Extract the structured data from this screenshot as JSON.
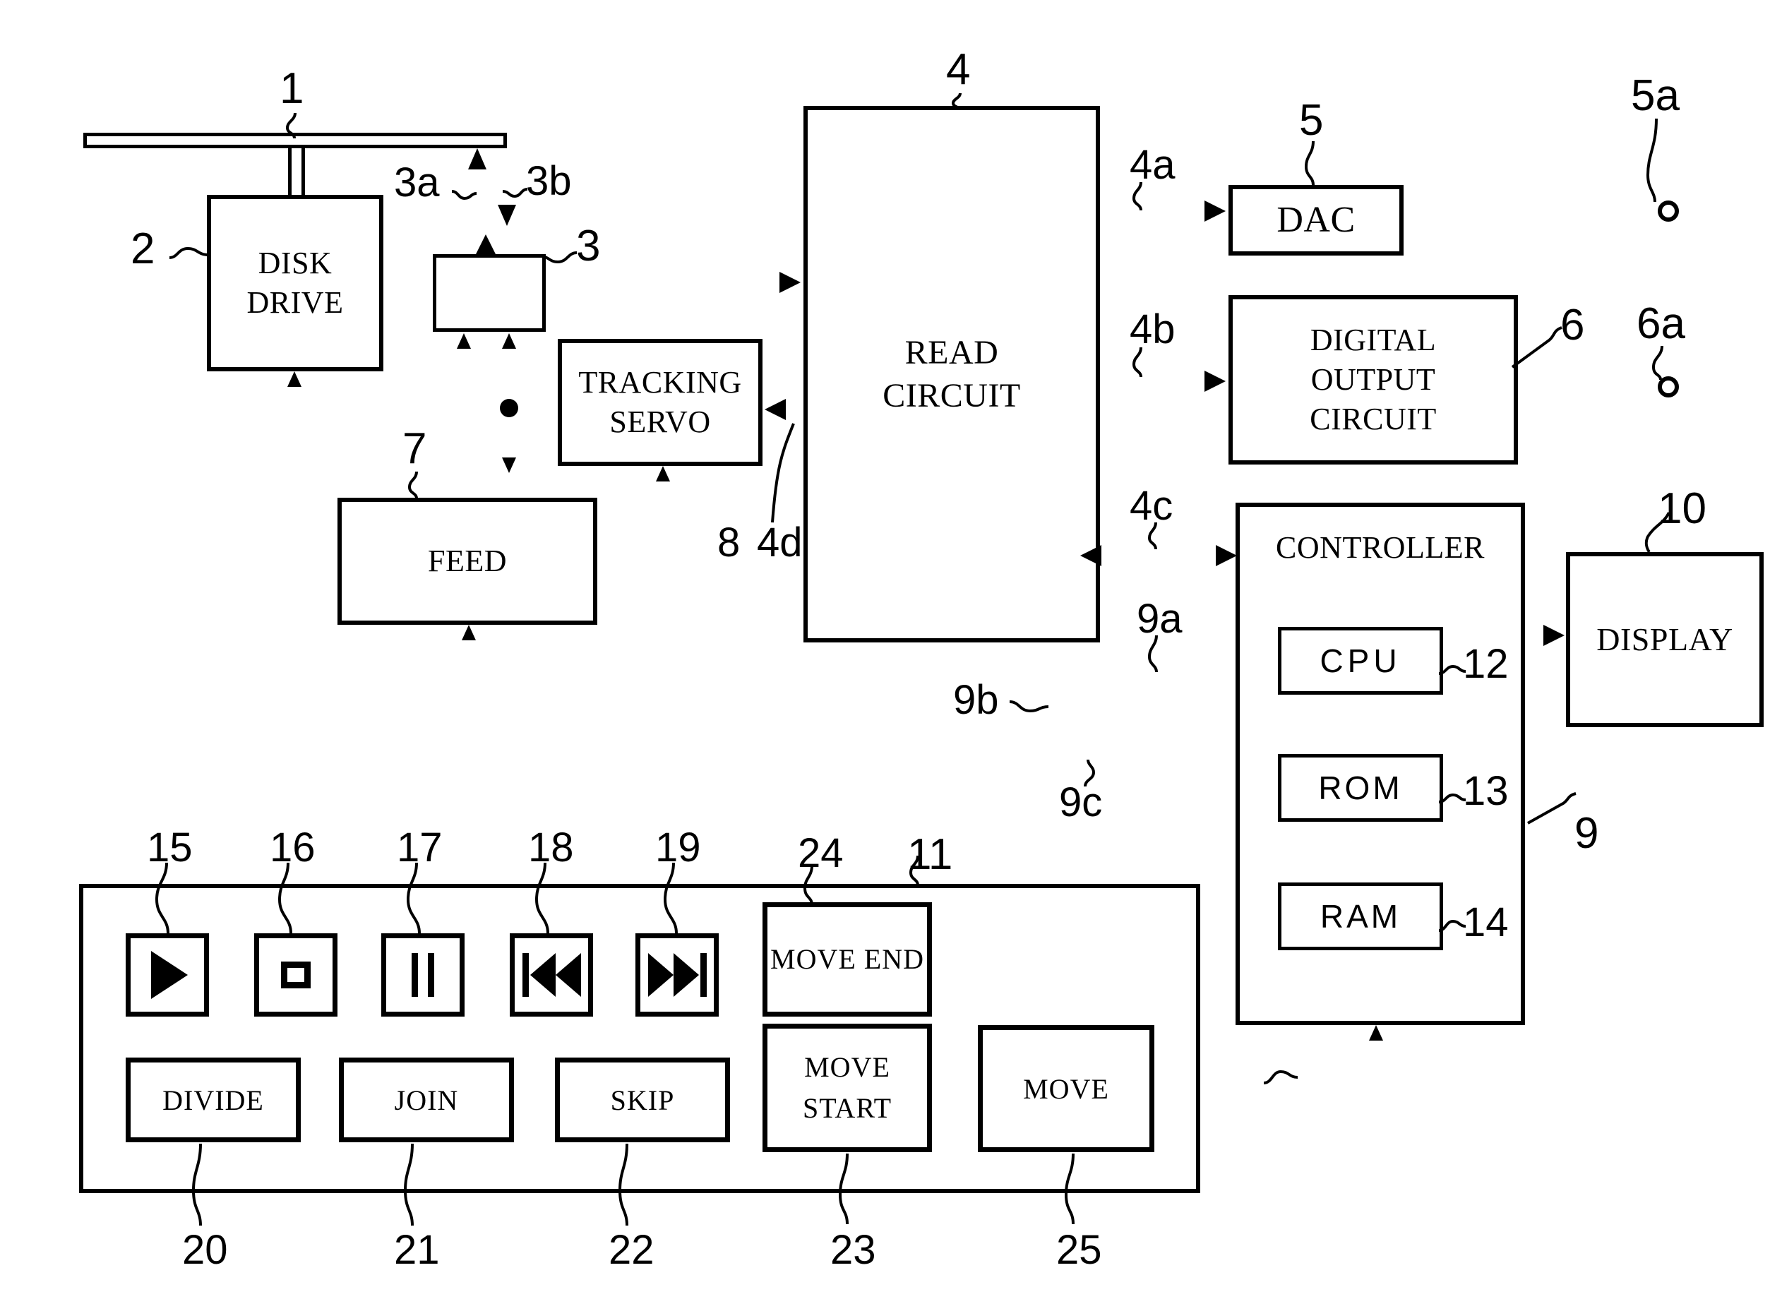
{
  "figure": {
    "title": "Optical disc playback apparatus block diagram",
    "blocks": {
      "disk_drive": "DISK DRIVE",
      "pickup": "",
      "tracking_servo_l1": "TRACKING",
      "tracking_servo_l2": "SERVO",
      "feed": "FEED",
      "read_circuit_l1": "READ",
      "read_circuit_l2": "CIRCUIT",
      "dac": "DAC",
      "digital_output_l1": "DIGITAL",
      "digital_output_l2": "OUTPUT",
      "digital_output_l3": "CIRCUIT",
      "controller": "CONTROLLER",
      "cpu": "CPU",
      "rom": "ROM",
      "ram": "RAM",
      "display": "DISPLAY"
    },
    "panel_keys": {
      "play": "play-triangle",
      "stop": "stop-square",
      "pause": "pause-bars",
      "prev": "skip-back",
      "next": "skip-forward",
      "divide": "DIVIDE",
      "join": "JOIN",
      "skip": "SKIP",
      "move_end_l1": "MOVE",
      "move_end_l2": "END",
      "move_start_l1": "MOVE",
      "move_start_l2": "START",
      "move": "MOVE"
    },
    "reference_numerals": {
      "disc": "1",
      "disk_drive": "2",
      "pickup": "3",
      "laser_up": "3a",
      "laser_down": "3b",
      "read_circuit": "4",
      "audio_out_line": "4a",
      "digital_out_line": "4b",
      "controller_line": "4c",
      "servo_line": "4d",
      "dac": "5",
      "analog_terminal": "5a",
      "digital_output_circuit": "6",
      "digital_terminal": "6a",
      "feed": "7",
      "tracking_servo": "8",
      "controller": "9",
      "bus_9a": "9a",
      "bus_9b": "9b",
      "bus_9c": "9c",
      "display": "10",
      "panel": "11",
      "cpu": "12",
      "rom": "13",
      "ram": "14",
      "play_key": "15",
      "stop_key": "16",
      "pause_key": "17",
      "prev_key": "18",
      "next_key": "19",
      "divide_key": "20",
      "join_key": "21",
      "skip_key": "22",
      "move_start_key": "23",
      "move_end_key": "24",
      "move_key": "25"
    }
  }
}
